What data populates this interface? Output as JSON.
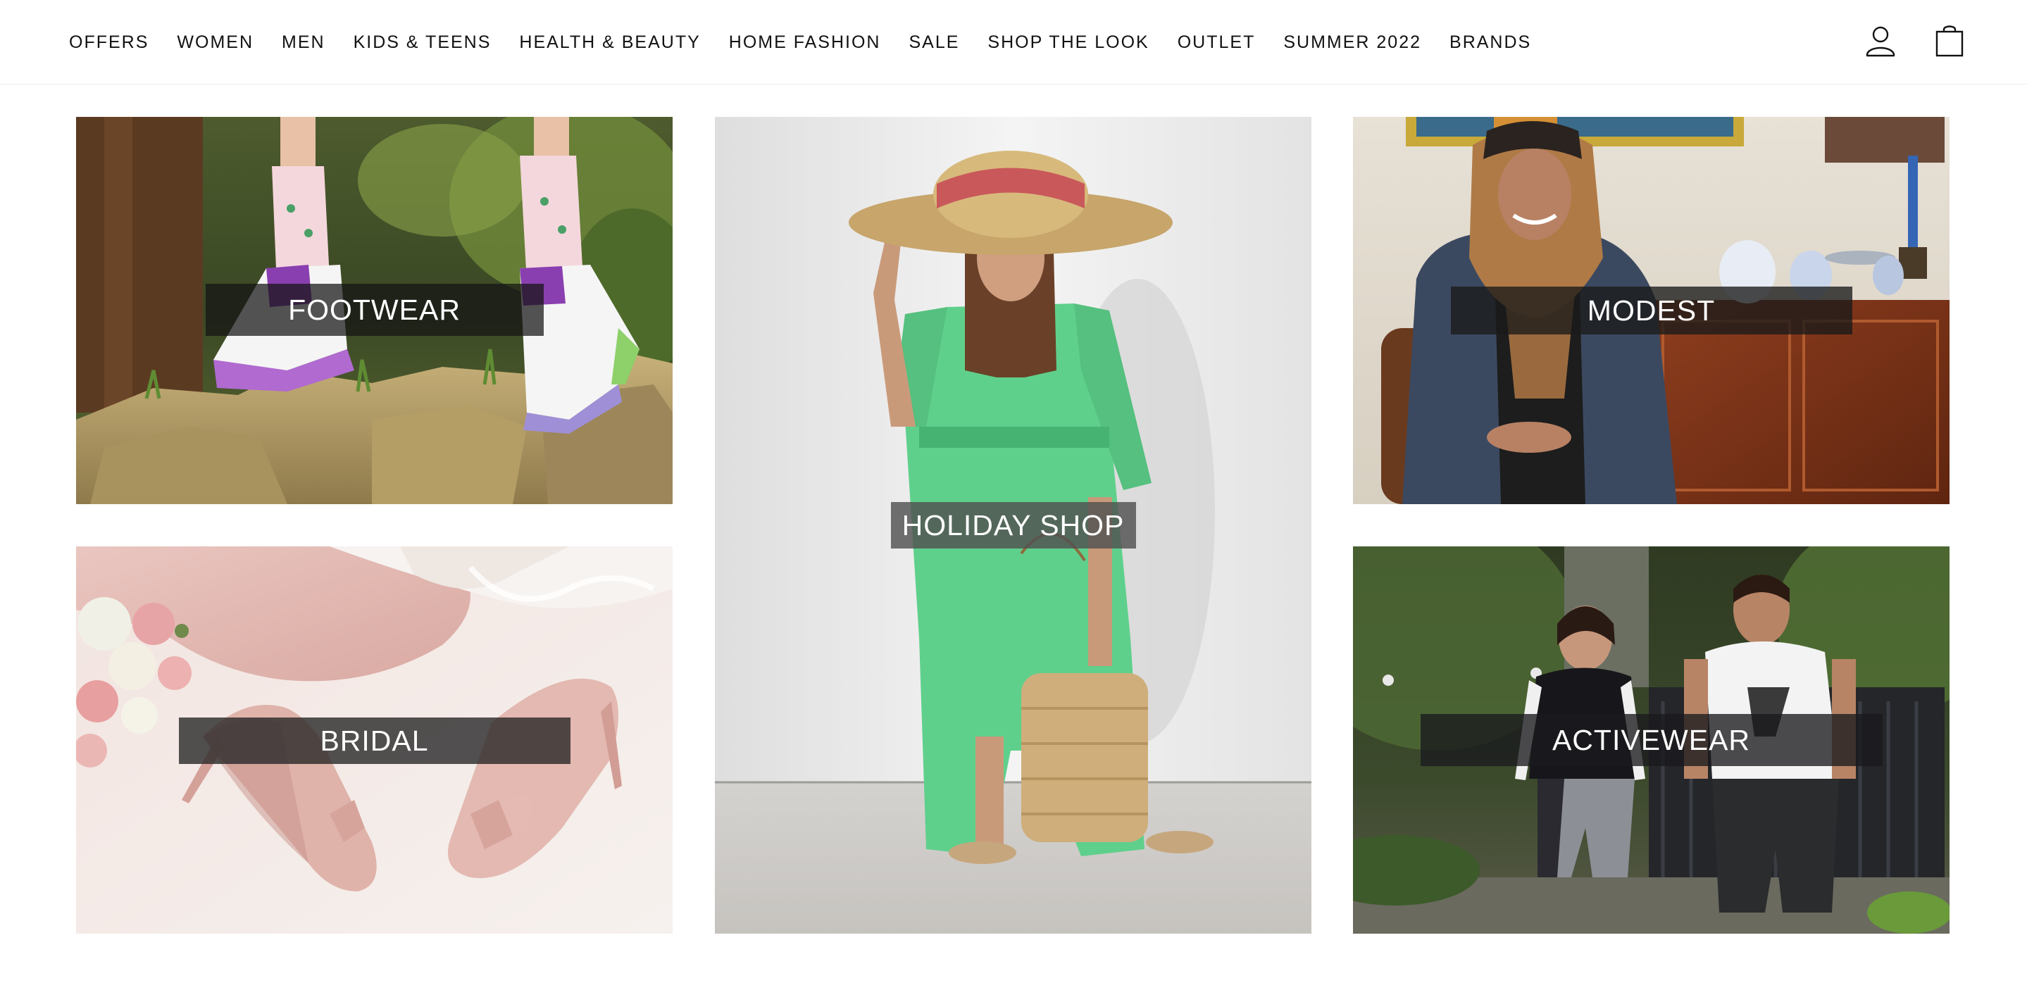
{
  "header": {
    "nav": [
      "OFFERS",
      "WOMEN",
      "MEN",
      "KIDS & TEENS",
      "HEALTH & BEAUTY",
      "HOME FASHION",
      "SALE",
      "SHOP THE LOOK",
      "OUTLET",
      "SUMMER 2022",
      "BRANDS"
    ],
    "icons": [
      "account-icon",
      "shopping-bag-icon"
    ]
  },
  "tiles": {
    "footwear": {
      "label": "FOOTWEAR"
    },
    "holiday": {
      "label": "HOLIDAY SHOP"
    },
    "modest": {
      "label": "MODEST"
    },
    "bridal": {
      "label": "BRIDAL"
    },
    "activewear": {
      "label": "ACTIVEWEAR"
    }
  }
}
